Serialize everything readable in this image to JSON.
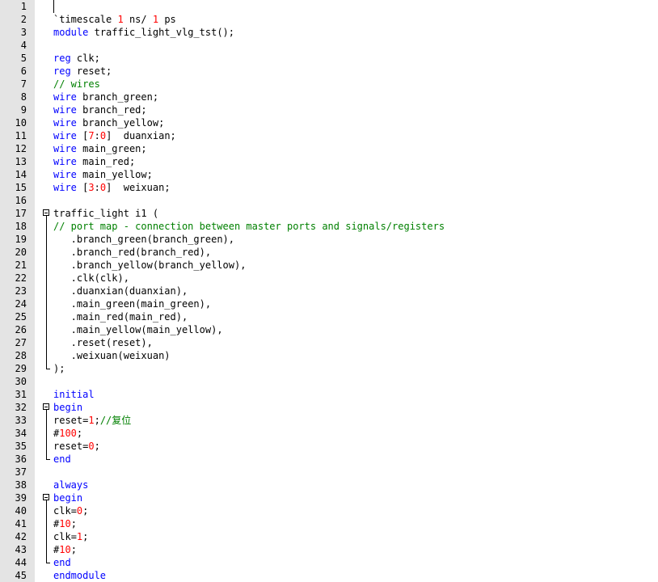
{
  "editor": {
    "lines": [
      {
        "n": "1",
        "t": ""
      },
      {
        "n": "2",
        "t": "`timescale 1 ns/ 1 ps"
      },
      {
        "n": "3",
        "t": "module traffic_light_vlg_tst();"
      },
      {
        "n": "4",
        "t": ""
      },
      {
        "n": "5",
        "t": "reg clk;"
      },
      {
        "n": "6",
        "t": "reg reset;"
      },
      {
        "n": "7",
        "t": "// wires"
      },
      {
        "n": "8",
        "t": "wire branch_green;"
      },
      {
        "n": "9",
        "t": "wire branch_red;"
      },
      {
        "n": "10",
        "t": "wire branch_yellow;"
      },
      {
        "n": "11",
        "t": "wire [7:0]  duanxian;"
      },
      {
        "n": "12",
        "t": "wire main_green;"
      },
      {
        "n": "13",
        "t": "wire main_red;"
      },
      {
        "n": "14",
        "t": "wire main_yellow;"
      },
      {
        "n": "15",
        "t": "wire [3:0]  weixuan;"
      },
      {
        "n": "16",
        "t": ""
      },
      {
        "n": "17",
        "t": "traffic_light i1 ("
      },
      {
        "n": "18",
        "t": "// port map - connection between master ports and signals/registers"
      },
      {
        "n": "19",
        "t": "   .branch_green(branch_green),"
      },
      {
        "n": "20",
        "t": "   .branch_red(branch_red),"
      },
      {
        "n": "21",
        "t": "   .branch_yellow(branch_yellow),"
      },
      {
        "n": "22",
        "t": "   .clk(clk),"
      },
      {
        "n": "23",
        "t": "   .duanxian(duanxian),"
      },
      {
        "n": "24",
        "t": "   .main_green(main_green),"
      },
      {
        "n": "25",
        "t": "   .main_red(main_red),"
      },
      {
        "n": "26",
        "t": "   .main_yellow(main_yellow),"
      },
      {
        "n": "27",
        "t": "   .reset(reset),"
      },
      {
        "n": "28",
        "t": "   .weixuan(weixuan)"
      },
      {
        "n": "29",
        "t": ");"
      },
      {
        "n": "30",
        "t": ""
      },
      {
        "n": "31",
        "t": "initial"
      },
      {
        "n": "32",
        "t": "begin"
      },
      {
        "n": "33",
        "t": "reset=1;//复位"
      },
      {
        "n": "34",
        "t": "#100;"
      },
      {
        "n": "35",
        "t": "reset=0;"
      },
      {
        "n": "36",
        "t": "end"
      },
      {
        "n": "37",
        "t": ""
      },
      {
        "n": "38",
        "t": "always"
      },
      {
        "n": "39",
        "t": "begin"
      },
      {
        "n": "40",
        "t": "clk=0;"
      },
      {
        "n": "41",
        "t": "#10;"
      },
      {
        "n": "42",
        "t": "clk=1;"
      },
      {
        "n": "43",
        "t": "#10;"
      },
      {
        "n": "44",
        "t": "end"
      },
      {
        "n": "45",
        "t": "endmodule"
      }
    ],
    "colors": {
      "keyword": "#0000ff",
      "number": "#ff0000",
      "comment": "#008000",
      "text": "#000000",
      "gutter": "#e4e4e4",
      "background": "#ffffff"
    }
  }
}
